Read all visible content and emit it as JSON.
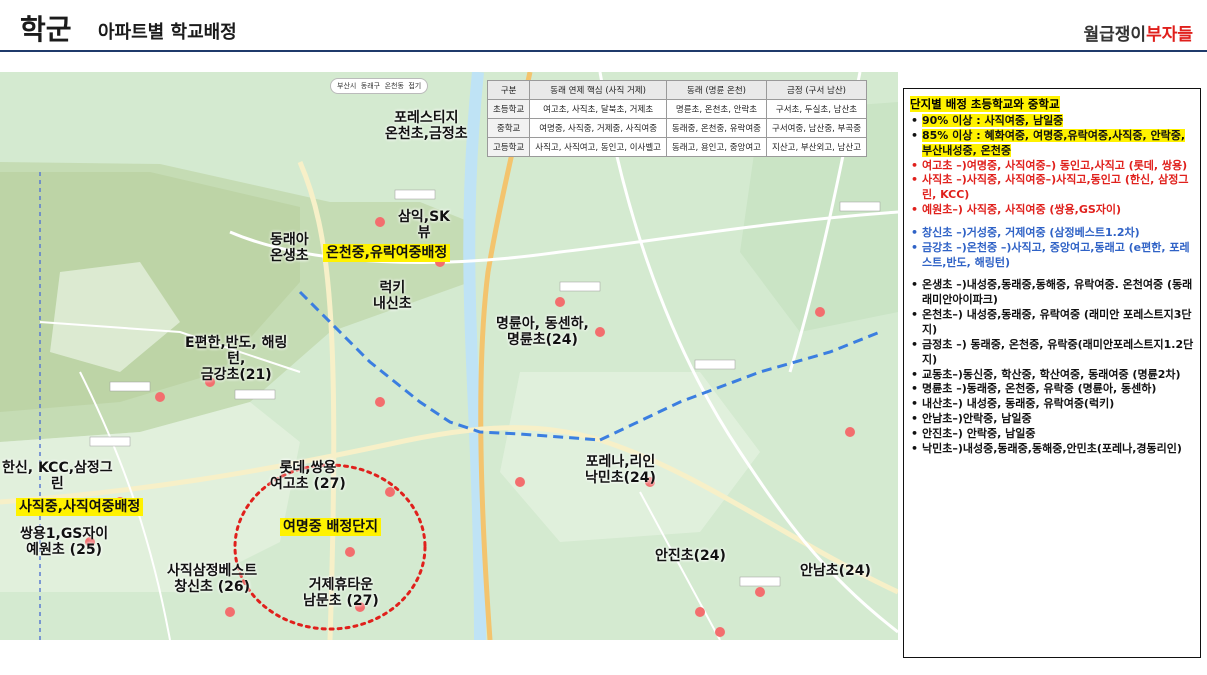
{
  "header": {
    "title": "학군",
    "subtitle": "아파트별 학교배정",
    "brand_a": "월급쟁이",
    "brand_b": "부자들"
  },
  "map_ui": {
    "chip1": "부산시",
    "chip2": "동래구",
    "chip3": "온천동",
    "chip4": "접기"
  },
  "table": {
    "headers": [
      "구분",
      "동래 연제 핵심 (사직 거제)",
      "동래 (명륜 온천)",
      "금정 (구서 남산)"
    ],
    "rows": [
      [
        "초등학교",
        "여고초, 사직초, 달북초, 거제초",
        "명륜초, 온천초, 안락초",
        "구서초, 두실초, 남산초"
      ],
      [
        "중학교",
        "여명중, 사직중, 거제중, 사직여중",
        "동래중, 온천중, 유락여중",
        "구서여중, 남산중, 부곡중"
      ],
      [
        "고등학교",
        "사직고, 사직여고, 동인고, 이사벨고",
        "동래고, 용인고, 중앙여고",
        "지산고, 부산외고, 남산고"
      ]
    ]
  },
  "labels": {
    "foreste": "포레스티지\n온천초,금정초",
    "samik": "삼익,SK\n뷰",
    "dongraea": "동래아\n온생초",
    "onchun_hl": "온천중,유락여중배정",
    "lucky": "럭키\n내신초",
    "myungryun": "명륜아, 동센하,\n명륜초(24)",
    "epyunhan": "E편한,반도, 해링\n턴,\n금강초(21)",
    "lotte": "롯데,쌍용\n여고초 (27)",
    "yeomyung_hl": "여명중 배정단지",
    "hanshin": "한신, KCC,삼정그\n린",
    "sajik_hl": "사직중,사직여중배정",
    "ssangyong": "쌍용1,GS자이\n예원초 (25)",
    "samjeong": "사직삼정베스트\n창신초 (26)",
    "geoje": "거제휴타운\n남문초 (27)",
    "porena": "포레나,리인\n낙민초(24)",
    "anjin": "안진초(24)",
    "annam": "안남초(24)"
  },
  "panel": {
    "title": "단지별 배정 초등학교와 중학교",
    "group1": [
      {
        "text": "90% 이상 : 사직여중, 남일중",
        "color": "black",
        "highlight": true
      },
      {
        "text": "85% 이상 : 혜화여중, 여명중,유락여중,사직중, 안락중, 부산내성중, 온천중",
        "color": "black",
        "highlight": true
      },
      {
        "text": "여고초 –)여명중, 사직여중–) 동인고,사직고 (롯데, 쌍용)",
        "color": "red"
      },
      {
        "text": "사직초 –)사직중, 사직여중–)사직고,동인고 (한신, 삼정그린, KCC)",
        "color": "red"
      },
      {
        "text": "예원초–) 사직중, 사직여중 (쌍용,GS자이)",
        "color": "red"
      }
    ],
    "group2": [
      {
        "text": "창신초 –)거성중, 거제여중 (삼정베스트1.2차)",
        "color": "blue"
      },
      {
        "text": "금강초 –)온천중 –)사직고, 중앙여고,동래고 (e편한, 포레스트,반도, 해링턴)",
        "color": "blue"
      }
    ],
    "group3": [
      {
        "text": "온생초 –)내성중,동래중,동해중, 유락여중. 온천여중 (동래래미안아이파크)",
        "color": "black"
      },
      {
        "text": "온천초–) 내성중,동래중, 유락여중 (래미안 포레스트지3단지)",
        "color": "black"
      },
      {
        "text": "금정초 –) 동래중, 온천중, 유락중(래미안포레스트지1.2단지)",
        "color": "black"
      },
      {
        "text": "교동초–)동신중, 학산중, 학산여중, 동래여중 (명륜2차)",
        "color": "black"
      },
      {
        "text": "명륜초 –)동래중, 온천중, 유락중 (명륜아, 동센하)",
        "color": "black"
      },
      {
        "text": "내산초–) 내성중, 동래중, 유락여중(럭키)",
        "color": "black"
      },
      {
        "text": "안남초–)안락중, 남일중",
        "color": "black"
      },
      {
        "text": "안진초–) 안락중, 남일중",
        "color": "black"
      },
      {
        "text": "낙민초–)내성중,동래중,동해중,안민초(포레나,경동리인)",
        "color": "black"
      }
    ]
  },
  "colors": {
    "highlight": "#fff200",
    "red": "#e0201c",
    "blue": "#2f62c6",
    "rule": "#1f3a6b"
  }
}
